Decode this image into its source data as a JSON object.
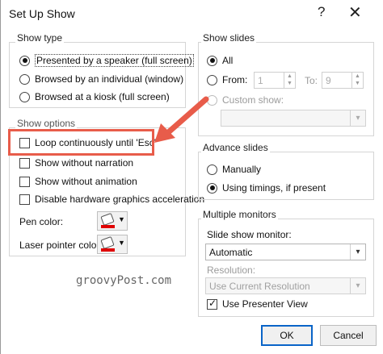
{
  "window": {
    "title": "Set Up Show",
    "help_label": "?",
    "close_label": "✕"
  },
  "show_type": {
    "label": "Show type",
    "options": [
      {
        "label": "Presented by a speaker (full screen)",
        "selected": true
      },
      {
        "label": "Browsed by an individual (window)",
        "selected": false
      },
      {
        "label": "Browsed at a kiosk (full screen)",
        "selected": false
      }
    ]
  },
  "show_options": {
    "label": "Show options",
    "items": [
      {
        "label": "Loop continuously until 'Esc'",
        "checked": false
      },
      {
        "label": "Show without narration",
        "checked": false
      },
      {
        "label": "Show without animation",
        "checked": false
      },
      {
        "label": "Disable hardware graphics acceleration",
        "checked": false
      }
    ],
    "pen_color_label": "Pen color:",
    "laser_color_label": "Laser pointer color:",
    "pen_color": "#e00000",
    "laser_color": "#e00000"
  },
  "show_slides": {
    "label": "Show slides",
    "all_label": "All",
    "from_label": "From:",
    "from_value": "1",
    "to_label": "To:",
    "to_value": "9",
    "custom_label": "Custom show:",
    "custom_value": ""
  },
  "advance_slides": {
    "label": "Advance slides",
    "options": [
      {
        "label": "Manually",
        "selected": false
      },
      {
        "label": "Using timings, if present",
        "selected": true
      }
    ]
  },
  "multiple_monitors": {
    "label": "Multiple monitors",
    "monitor_label": "Slide show monitor:",
    "monitor_value": "Automatic",
    "resolution_label": "Resolution:",
    "resolution_value": "Use Current Resolution",
    "presenter_view_label": "Use Presenter View",
    "presenter_view_checked": true
  },
  "buttons": {
    "ok": "OK",
    "cancel": "Cancel"
  },
  "watermark": "groovyPost.com",
  "colors": {
    "accent": "#0a64c8",
    "annotation": "#e85c4a",
    "background_edge": "#c0392b"
  }
}
